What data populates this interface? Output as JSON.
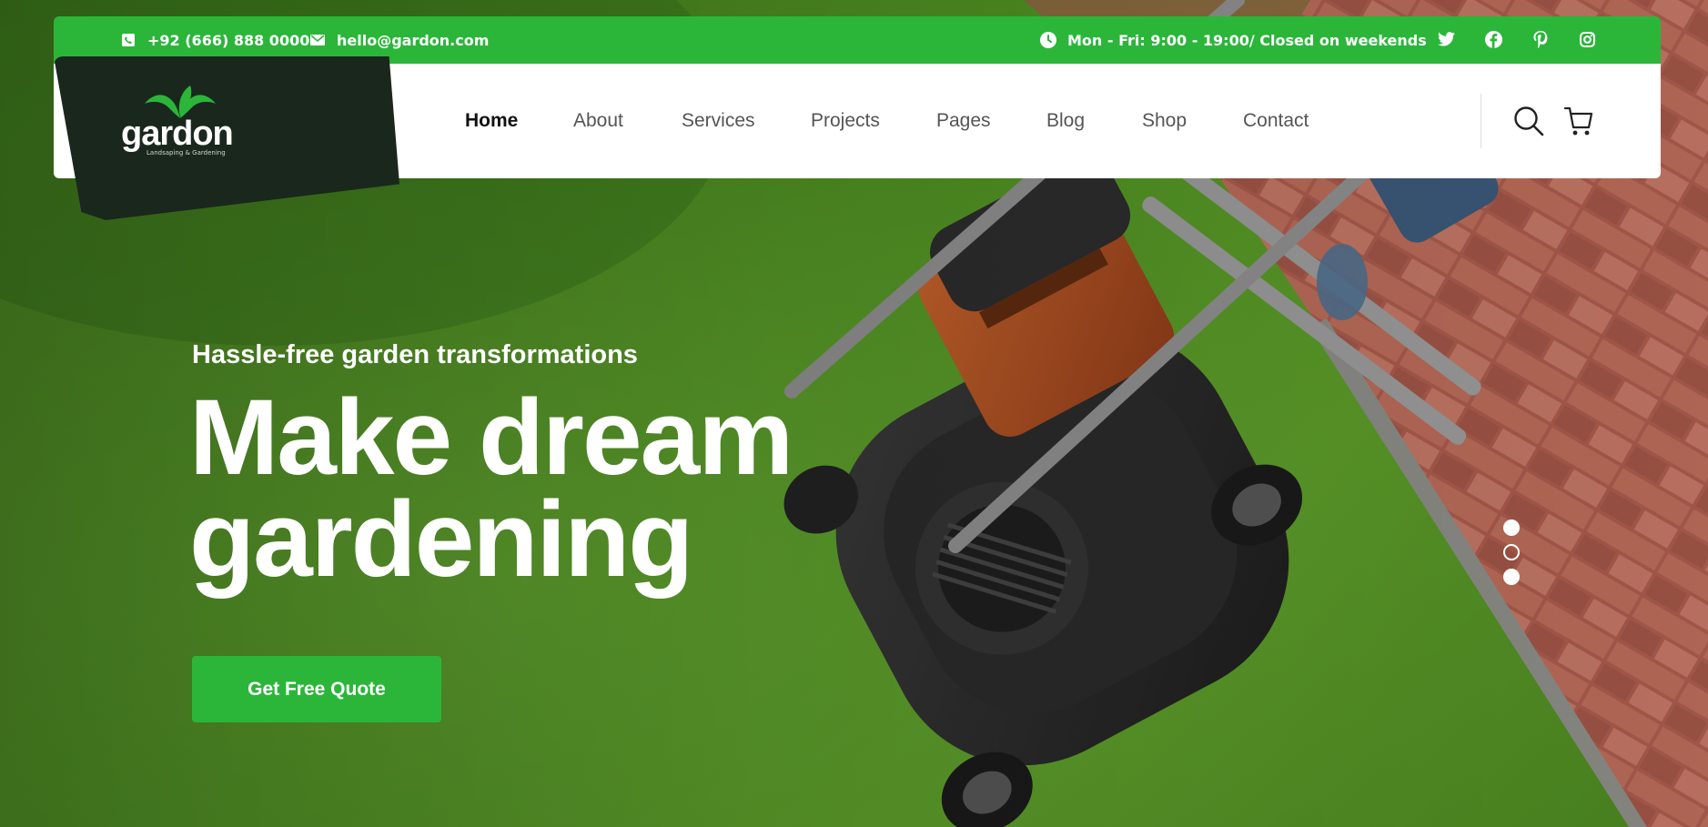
{
  "topbar": {
    "phone": "+92 (666) 888 0000",
    "email": "hello@gardon.com",
    "hours": "Mon - Fri: 9:00 - 19:00/ Closed on weekends",
    "social": [
      "twitter-icon",
      "facebook-icon",
      "pinterest-icon",
      "instagram-icon"
    ],
    "icons": {
      "phone": "phone-icon",
      "email": "envelope-icon",
      "hours": "clock-icon"
    }
  },
  "brand": {
    "name": "gardon",
    "tagline": "Landsaping & Gardening"
  },
  "nav": {
    "items": [
      {
        "label": "Home",
        "active": true
      },
      {
        "label": "About",
        "active": false
      },
      {
        "label": "Services",
        "active": false
      },
      {
        "label": "Projects",
        "active": false
      },
      {
        "label": "Pages",
        "active": false
      },
      {
        "label": "Blog",
        "active": false
      },
      {
        "label": "Shop",
        "active": false
      },
      {
        "label": "Contact",
        "active": false
      }
    ],
    "icons": [
      "search-icon",
      "cart-icon"
    ]
  },
  "hero": {
    "eyebrow": "Hassle-free garden transformations",
    "headline_line1": "Make dream",
    "headline_line2": "gardening",
    "cta": "Get Free Quote",
    "slides": [
      {
        "state": "filled"
      },
      {
        "state": "active-hollow"
      },
      {
        "state": "filled"
      }
    ]
  },
  "colors": {
    "accent": "#2bb63a",
    "logo_bg": "#1a271d",
    "nav_bg": "#ffffff",
    "text_white": "#ffffff"
  }
}
